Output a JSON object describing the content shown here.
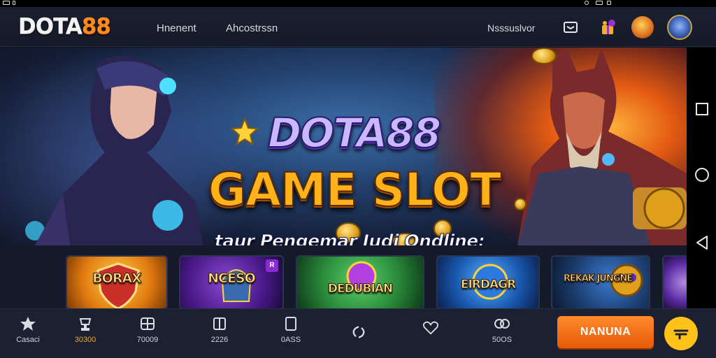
{
  "brand": {
    "logo_part1": "DOTA",
    "logo_part2": "88"
  },
  "header": {
    "nav": [
      "Hnenent",
      "Ahcostrssn"
    ],
    "right_link": "Nsssuslvor"
  },
  "hero": {
    "title_line1": "DOTA88",
    "title_line2": "GAME SLOT",
    "subtitle": "taur Pengemar Judi Ondline:"
  },
  "games": [
    {
      "label": "BORAX",
      "color": "#e8941a"
    },
    {
      "label": "NCESO",
      "badge": "R",
      "color": "#6a2fb0"
    },
    {
      "label": "DEDUBIAN",
      "color": "#3fb04a"
    },
    {
      "label": "EIRDAGR",
      "color": "#2a78d0"
    },
    {
      "label": "REKAK JUNGNE",
      "color": "#1a4a7a"
    }
  ],
  "bottom_nav": [
    {
      "icon": "star-icon",
      "label": "Casaci"
    },
    {
      "icon": "trophy-icon",
      "label": "30300",
      "active": true
    },
    {
      "icon": "grid-icon",
      "label": "70009"
    },
    {
      "icon": "book-icon",
      "label": "2226"
    },
    {
      "icon": "tablet-icon",
      "label": "0ASS"
    },
    {
      "icon": "share-icon",
      "label": ""
    },
    {
      "icon": "heart-icon",
      "label": ""
    },
    {
      "icon": "dice-icon",
      "label": "50OS"
    }
  ],
  "cta": {
    "label": "NANUNA"
  },
  "colors": {
    "accent": "#f47b20",
    "active_nav": "#f5a623",
    "cta_round": "#ffc21a"
  }
}
